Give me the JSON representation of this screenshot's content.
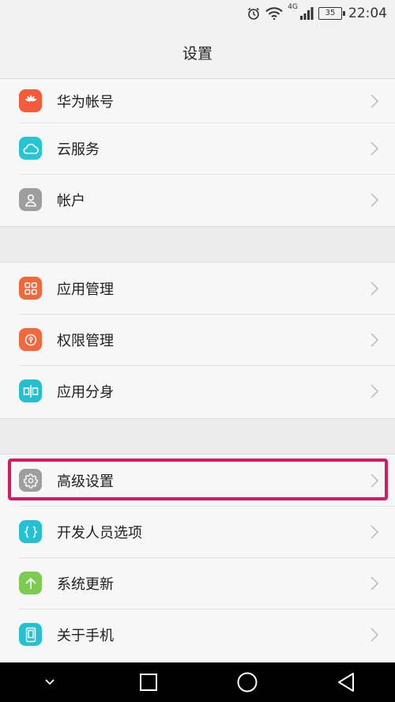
{
  "status_bar": {
    "network": "4G",
    "battery": "35",
    "time": "22:04"
  },
  "title": "设置",
  "groups": [
    {
      "items": [
        {
          "label": "华为帐号",
          "icon": "huawei-icon",
          "color": "#f45b3c"
        },
        {
          "label": "云服务",
          "icon": "cloud-icon",
          "color": "#27c4d6"
        },
        {
          "label": "帐户",
          "icon": "person-icon",
          "color": "#9e9e9e"
        }
      ]
    },
    {
      "items": [
        {
          "label": "应用管理",
          "icon": "app-grid-icon",
          "color": "#f2683e"
        },
        {
          "label": "权限管理",
          "icon": "key-lock-icon",
          "color": "#f2683e"
        },
        {
          "label": "应用分身",
          "icon": "app-twin-icon",
          "color": "#26bfcf"
        }
      ]
    },
    {
      "items": [
        {
          "label": "高级设置",
          "icon": "gear-icon",
          "color": "#9e9e9e"
        },
        {
          "label": "开发人员选项",
          "icon": "braces-icon",
          "color": "#26c0d3"
        },
        {
          "label": "系统更新",
          "icon": "arrow-up-icon",
          "color": "#7ccb52"
        },
        {
          "label": "关于手机",
          "icon": "phone-icon",
          "color": "#26c0d3"
        }
      ]
    }
  ],
  "highlight_color": "#d81b60"
}
